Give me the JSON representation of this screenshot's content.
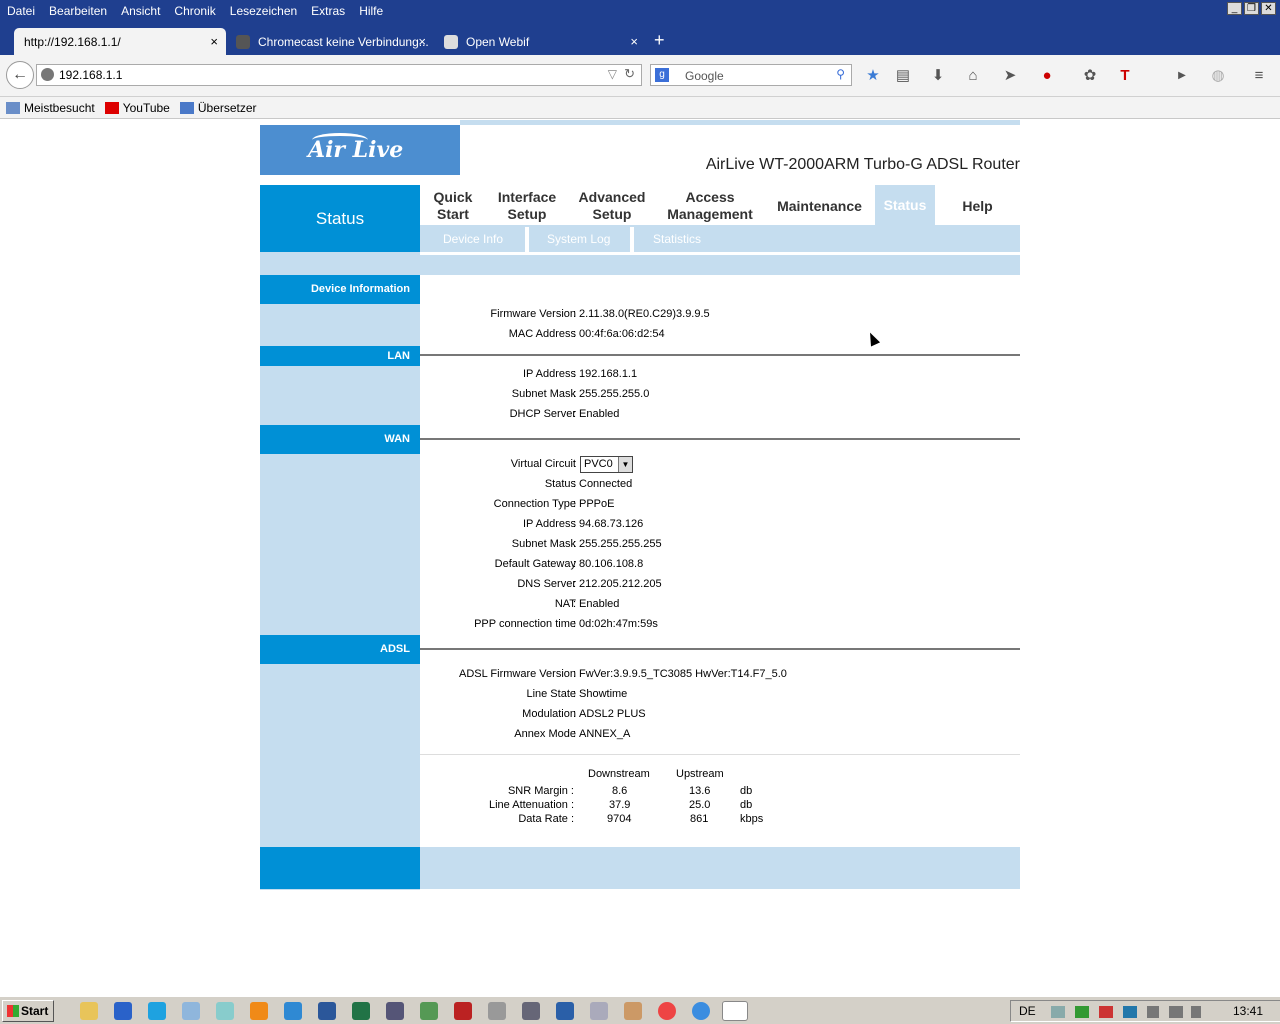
{
  "browser": {
    "menu": [
      "Datei",
      "Bearbeiten",
      "Ansicht",
      "Chronik",
      "Lesezeichen",
      "Extras",
      "Hilfe"
    ],
    "tabs": [
      {
        "title": "http://192.168.1.1/"
      },
      {
        "title": "Chromecast keine Verbindung..."
      },
      {
        "title": "Open Webif"
      }
    ],
    "url": "192.168.1.1",
    "search_placeholder": "Google",
    "bookmarks": [
      "Meistbesucht",
      "YouTube",
      "Übersetzer"
    ]
  },
  "router": {
    "product": "AirLive WT-2000ARM Turbo-G ADSL Router",
    "logo_text": "Air Live",
    "nav_title": "Status",
    "menu": [
      {
        "label": "Quick\nStart"
      },
      {
        "label": "Interface\nSetup"
      },
      {
        "label": "Advanced\nSetup"
      },
      {
        "label": "Access\nManagement"
      },
      {
        "label": "Maintenance"
      },
      {
        "label": "Status"
      },
      {
        "label": "Help"
      }
    ],
    "submenu": [
      "Device Info",
      "System Log",
      "Statistics"
    ],
    "sections": {
      "device": "Device Information",
      "lan": "LAN",
      "wan": "WAN",
      "adsl": "ADSL"
    },
    "device": {
      "firmware_label": "Firmware Version",
      "firmware": "2.11.38.0(RE0.C29)3.9.9.5",
      "mac_label": "MAC Address",
      "mac": "00:4f:6a:06:d2:54"
    },
    "lan": {
      "ip_label": "IP Address",
      "ip": "192.168.1.1",
      "mask_label": "Subnet Mask",
      "mask": "255.255.255.0",
      "dhcp_label": "DHCP Server",
      "dhcp": "Enabled"
    },
    "wan": {
      "vc_label": "Virtual Circuit",
      "vc": "PVC0",
      "status_label": "Status",
      "status": "Connected",
      "type_label": "Connection Type",
      "type": "PPPoE",
      "ip_label": "IP Address",
      "ip": "94.68.73.126",
      "mask_label": "Subnet Mask",
      "mask": "255.255.255.255",
      "gw_label": "Default Gateway",
      "gw": "80.106.108.8",
      "dns_label": "DNS Server",
      "dns": "212.205.212.205",
      "nat_label": "NAT",
      "nat": "Enabled",
      "ppp_label": "PPP connection time",
      "ppp": "0d:02h:47m:59s"
    },
    "adsl": {
      "fw_label": "ADSL Firmware Version",
      "fw": "FwVer:3.9.9.5_TC3085 HwVer:T14.F7_5.0",
      "state_label": "Line State",
      "state": "Showtime",
      "mod_label": "Modulation",
      "mod": "ADSL2 PLUS",
      "annex_label": "Annex Mode",
      "annex": "ANNEX_A"
    },
    "stats": {
      "downstream": "Downstream",
      "upstream": "Upstream",
      "rows": [
        {
          "label": "SNR Margin :",
          "down": "8.6",
          "up": "13.6",
          "unit": "db"
        },
        {
          "label": "Line Attenuation :",
          "down": "37.9",
          "up": "25.0",
          "unit": "db"
        },
        {
          "label": "Data Rate :",
          "down": "9704",
          "up": "861",
          "unit": "kbps"
        }
      ]
    }
  },
  "taskbar": {
    "start": "Start",
    "lang": "DE",
    "clock": "13:41"
  }
}
